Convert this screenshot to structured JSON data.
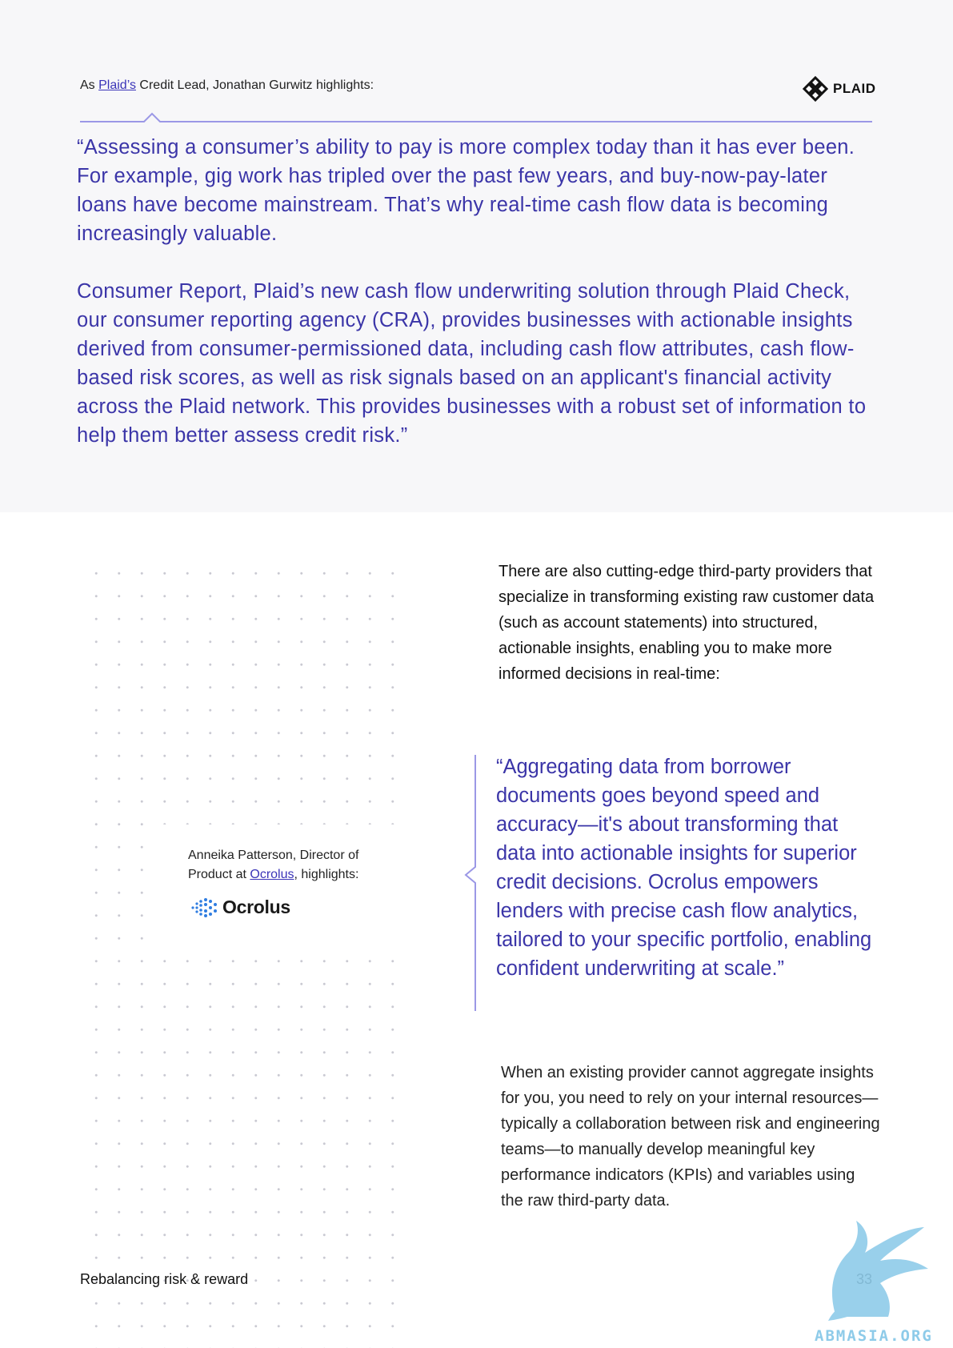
{
  "header": {
    "intro_prefix": "As ",
    "intro_link": "Plaid’s",
    "intro_suffix": " Credit Lead, Jonathan Gurwitz highlights:",
    "logo_text": "PLAID"
  },
  "quote_plaid": {
    "paragraph_1": "“Assessing a consumer’s ability to pay is more complex today than it has ever been. For example, gig work has tripled over the past few years, and buy-now-pay-later loans have become mainstream. That’s why real-time cash flow data is becoming increasingly valuable.",
    "paragraph_2": "Consumer Report, Plaid’s new cash flow underwriting solution through Plaid Check, our consumer reporting agency (CRA), provides businesses with actionable insights derived from consumer-permissioned data, including cash flow attributes, cash flow-based risk scores, as well as risk signals based on an applicant's financial activity across the Plaid network. This provides businesses with a robust set of information to help them better assess credit risk.”"
  },
  "body": {
    "paragraph_1": "There are also cutting-edge third-party providers that specialize in transforming existing raw customer data (such as account statements) into structured, actionable insights, enabling you to make more informed decisions in real-time:",
    "paragraph_2": "When an existing provider cannot aggregate insights for you, you need to rely on your internal resources—typically a collaboration between risk and engineering teams—to manually develop meaningful key performance indicators (KPIs) and variables using the raw third-party data."
  },
  "attribution": {
    "prefix": "Anneika Patterson, Director of Product at ",
    "link": "Ocrolus",
    "suffix": ", highlights:",
    "logo_text": "Ocrolus"
  },
  "quote_ocrolus": {
    "text": "“Aggregating data from borrower documents goes beyond speed and accuracy—it's about transforming that data into actionable insights for superior credit decisions. Ocrolus empowers lenders with precise cash flow analytics, tailored to your specific portfolio, enabling confident underwriting at scale.”"
  },
  "footer": {
    "title": "Rebalancing risk & reward",
    "page_number": "33"
  },
  "watermark": {
    "text": "ABMASIA.ORG"
  },
  "colors": {
    "quote_purple": "#3b35a8",
    "divider_lavender": "#9b98e6",
    "panel_gray": "#f7f7f9",
    "watermark_blue": "#8ecbe9"
  }
}
